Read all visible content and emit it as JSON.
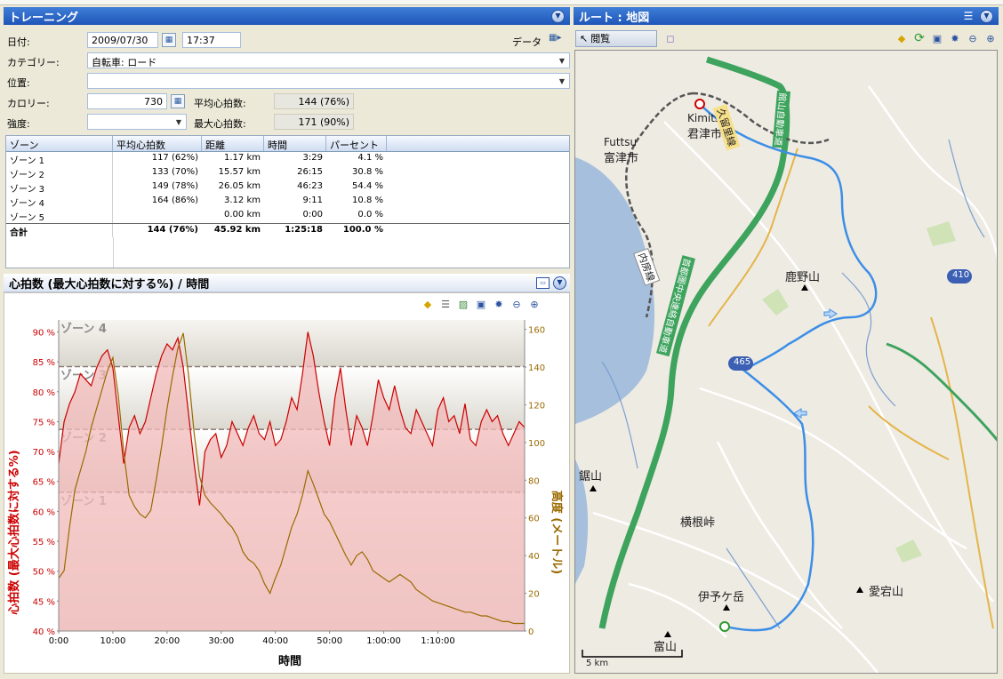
{
  "training": {
    "title": "トレーニング",
    "date_label": "日付:",
    "date": "2009/07/30",
    "time": "17:37",
    "data_label": "データ",
    "category_label": "カテゴリー:",
    "category": "自転車: ロード",
    "location_label": "位置:",
    "location": "",
    "calories_label": "カロリー:",
    "calories": "730",
    "avg_hr_label": "平均心拍数:",
    "avg_hr": "144 (76%)",
    "intensity_label": "強度:",
    "intensity": "",
    "max_hr_label": "最大心拍数:",
    "max_hr": "171 (90%)"
  },
  "zones": {
    "headers": [
      "ゾーン",
      "平均心拍数",
      "距離",
      "時間",
      "パーセント"
    ],
    "rows": [
      [
        "ゾーン 1",
        "117 (62%)",
        "1.17 km",
        "3:29",
        "4.1 %"
      ],
      [
        "ゾーン 2",
        "133 (70%)",
        "15.57 km",
        "26:15",
        "30.8 %"
      ],
      [
        "ゾーン 3",
        "149 (78%)",
        "26.05 km",
        "46:23",
        "54.4 %"
      ],
      [
        "ゾーン 4",
        "164 (86%)",
        "3.12 km",
        "9:11",
        "10.8 %"
      ],
      [
        "ゾーン 5",
        "",
        "0.00 km",
        "0:00",
        "0.0 %"
      ]
    ],
    "total": [
      "合計",
      "144 (76%)",
      "45.92 km",
      "1:25:18",
      "100.0 %"
    ]
  },
  "chart_panel": {
    "title": "心拍数 (最大心拍数に対する%) / 時間"
  },
  "chart_data": {
    "type": "line",
    "title": "",
    "xlabel": "時間",
    "ylabel": "心拍数 (最大心拍数に対する%)",
    "y2label": "高度 (メートル)",
    "ylim": [
      40,
      92
    ],
    "y2lim": [
      0,
      165
    ],
    "xlim": [
      0,
      86
    ],
    "x_ticks": [
      "0:00",
      "10:00",
      "20:00",
      "30:00",
      "40:00",
      "50:00",
      "1:00:00",
      "1:10:00"
    ],
    "x_tick_values": [
      0,
      10,
      20,
      30,
      40,
      50,
      60,
      70
    ],
    "y_ticks": [
      "90 %",
      "85 %",
      "80 %",
      "75 %",
      "70 %",
      "65 %",
      "60 %",
      "55 %",
      "50 %",
      "45 %",
      "40 %"
    ],
    "y_tick_values": [
      90,
      85,
      80,
      75,
      70,
      65,
      60,
      55,
      50,
      45,
      40
    ],
    "y2_ticks": [
      "160",
      "140",
      "120",
      "100",
      "80",
      "60",
      "40",
      "20",
      "0"
    ],
    "y2_tick_values": [
      160,
      140,
      120,
      100,
      80,
      60,
      40,
      20,
      0
    ],
    "zones": [
      {
        "name": "ゾーン 4",
        "from": 84.2,
        "to": 92
      },
      {
        "name": "ゾーン 3",
        "from": 73.7,
        "to": 84.2
      },
      {
        "name": "ゾーン 2",
        "from": 63.2,
        "to": 73.7
      },
      {
        "name": "ゾーン 1",
        "from": 40,
        "to": 63.2
      }
    ],
    "zone_labels": [
      "ゾーン 4",
      "ゾーン 3",
      "ゾーン 2",
      "ゾーン 1"
    ],
    "series": [
      {
        "name": "心拍数",
        "axis": "left",
        "color": "#cc0000",
        "fill": "#f2b9b9",
        "x": [
          0,
          1,
          2,
          3,
          4,
          5,
          6,
          7,
          8,
          9,
          10,
          11,
          12,
          13,
          14,
          15,
          16,
          17,
          18,
          19,
          20,
          21,
          22,
          23,
          24,
          25,
          26,
          27,
          28,
          29,
          30,
          31,
          32,
          33,
          34,
          35,
          36,
          37,
          38,
          39,
          40,
          41,
          42,
          43,
          44,
          45,
          46,
          47,
          48,
          49,
          50,
          51,
          52,
          53,
          54,
          55,
          56,
          57,
          58,
          59,
          60,
          61,
          62,
          63,
          64,
          65,
          66,
          67,
          68,
          69,
          70,
          71,
          72,
          73,
          74,
          75,
          76,
          77,
          78,
          79,
          80,
          81,
          82,
          83,
          84,
          85,
          86
        ],
        "y": [
          68,
          75,
          78,
          80,
          83,
          82,
          81,
          84,
          86,
          87,
          84,
          76,
          68,
          74,
          76,
          73,
          75,
          79,
          83,
          86,
          88,
          87,
          89,
          84,
          76,
          68,
          61,
          70,
          72,
          73,
          69,
          71,
          75,
          73,
          71,
          74,
          76,
          73,
          72,
          75,
          71,
          72,
          75,
          79,
          77,
          83,
          90,
          86,
          80,
          75,
          71,
          79,
          84,
          77,
          71,
          76,
          74,
          71,
          76,
          82,
          79,
          77,
          81,
          77,
          74,
          73,
          77,
          75,
          73,
          71,
          77,
          79,
          75,
          76,
          73,
          78,
          72,
          71,
          75,
          77,
          75,
          76,
          73,
          71,
          73,
          75,
          74
        ]
      },
      {
        "name": "高度",
        "axis": "right",
        "color": "#9a6a00",
        "x": [
          0,
          1,
          2,
          3,
          4,
          5,
          6,
          7,
          8,
          9,
          10,
          11,
          12,
          13,
          14,
          15,
          16,
          17,
          18,
          19,
          20,
          21,
          22,
          23,
          24,
          25,
          26,
          27,
          28,
          29,
          30,
          31,
          32,
          33,
          34,
          35,
          36,
          37,
          38,
          39,
          40,
          41,
          42,
          43,
          44,
          45,
          46,
          47,
          48,
          49,
          50,
          51,
          52,
          53,
          54,
          55,
          56,
          57,
          58,
          59,
          60,
          61,
          62,
          63,
          64,
          65,
          66,
          67,
          68,
          69,
          70,
          71,
          72,
          73,
          74,
          75,
          76,
          77,
          78,
          79,
          80,
          81,
          82,
          83,
          84,
          85,
          86
        ],
        "y": [
          28,
          32,
          55,
          75,
          85,
          95,
          108,
          118,
          128,
          138,
          145,
          125,
          95,
          72,
          66,
          62,
          60,
          64,
          80,
          98,
          118,
          135,
          150,
          158,
          135,
          105,
          82,
          72,
          68,
          65,
          62,
          58,
          55,
          50,
          42,
          38,
          36,
          32,
          25,
          20,
          28,
          35,
          45,
          55,
          62,
          72,
          85,
          78,
          70,
          62,
          58,
          52,
          46,
          40,
          35,
          40,
          42,
          38,
          32,
          30,
          28,
          26,
          28,
          30,
          28,
          26,
          22,
          20,
          18,
          16,
          15,
          14,
          13,
          12,
          11,
          10,
          10,
          9,
          8,
          8,
          7,
          6,
          5,
          5,
          4,
          4,
          4
        ]
      }
    ]
  },
  "map": {
    "title": "ルート : 地図",
    "view_button": "閲覧",
    "labels": {
      "kimitsu_en": "Kimitsu",
      "kimitsu": "君津市",
      "futtsu_en": "Futtsu",
      "futtsu": "富津市",
      "kanoyama": "鹿野山",
      "nokogiriyama": "鋸山",
      "yokone": "横根峠",
      "iyogatake": "伊予ケ岳",
      "atagoyama": "愛宕山",
      "tomiyama": "富山",
      "kururi": "久留里線",
      "uchibo": "内房線",
      "tateyama_exp": "館山自動車道",
      "kenodo": "首都圏中央連絡自動車道",
      "r410": "410",
      "r465": "465",
      "scale": "5 km"
    }
  },
  "colors": {
    "titlebar": "#1f56b8",
    "hr_line": "#cc0000",
    "hr_fill": "#f2b9b9",
    "altitude": "#9a6a00",
    "route": "#3c8ee6",
    "highway": "#3da35d"
  }
}
